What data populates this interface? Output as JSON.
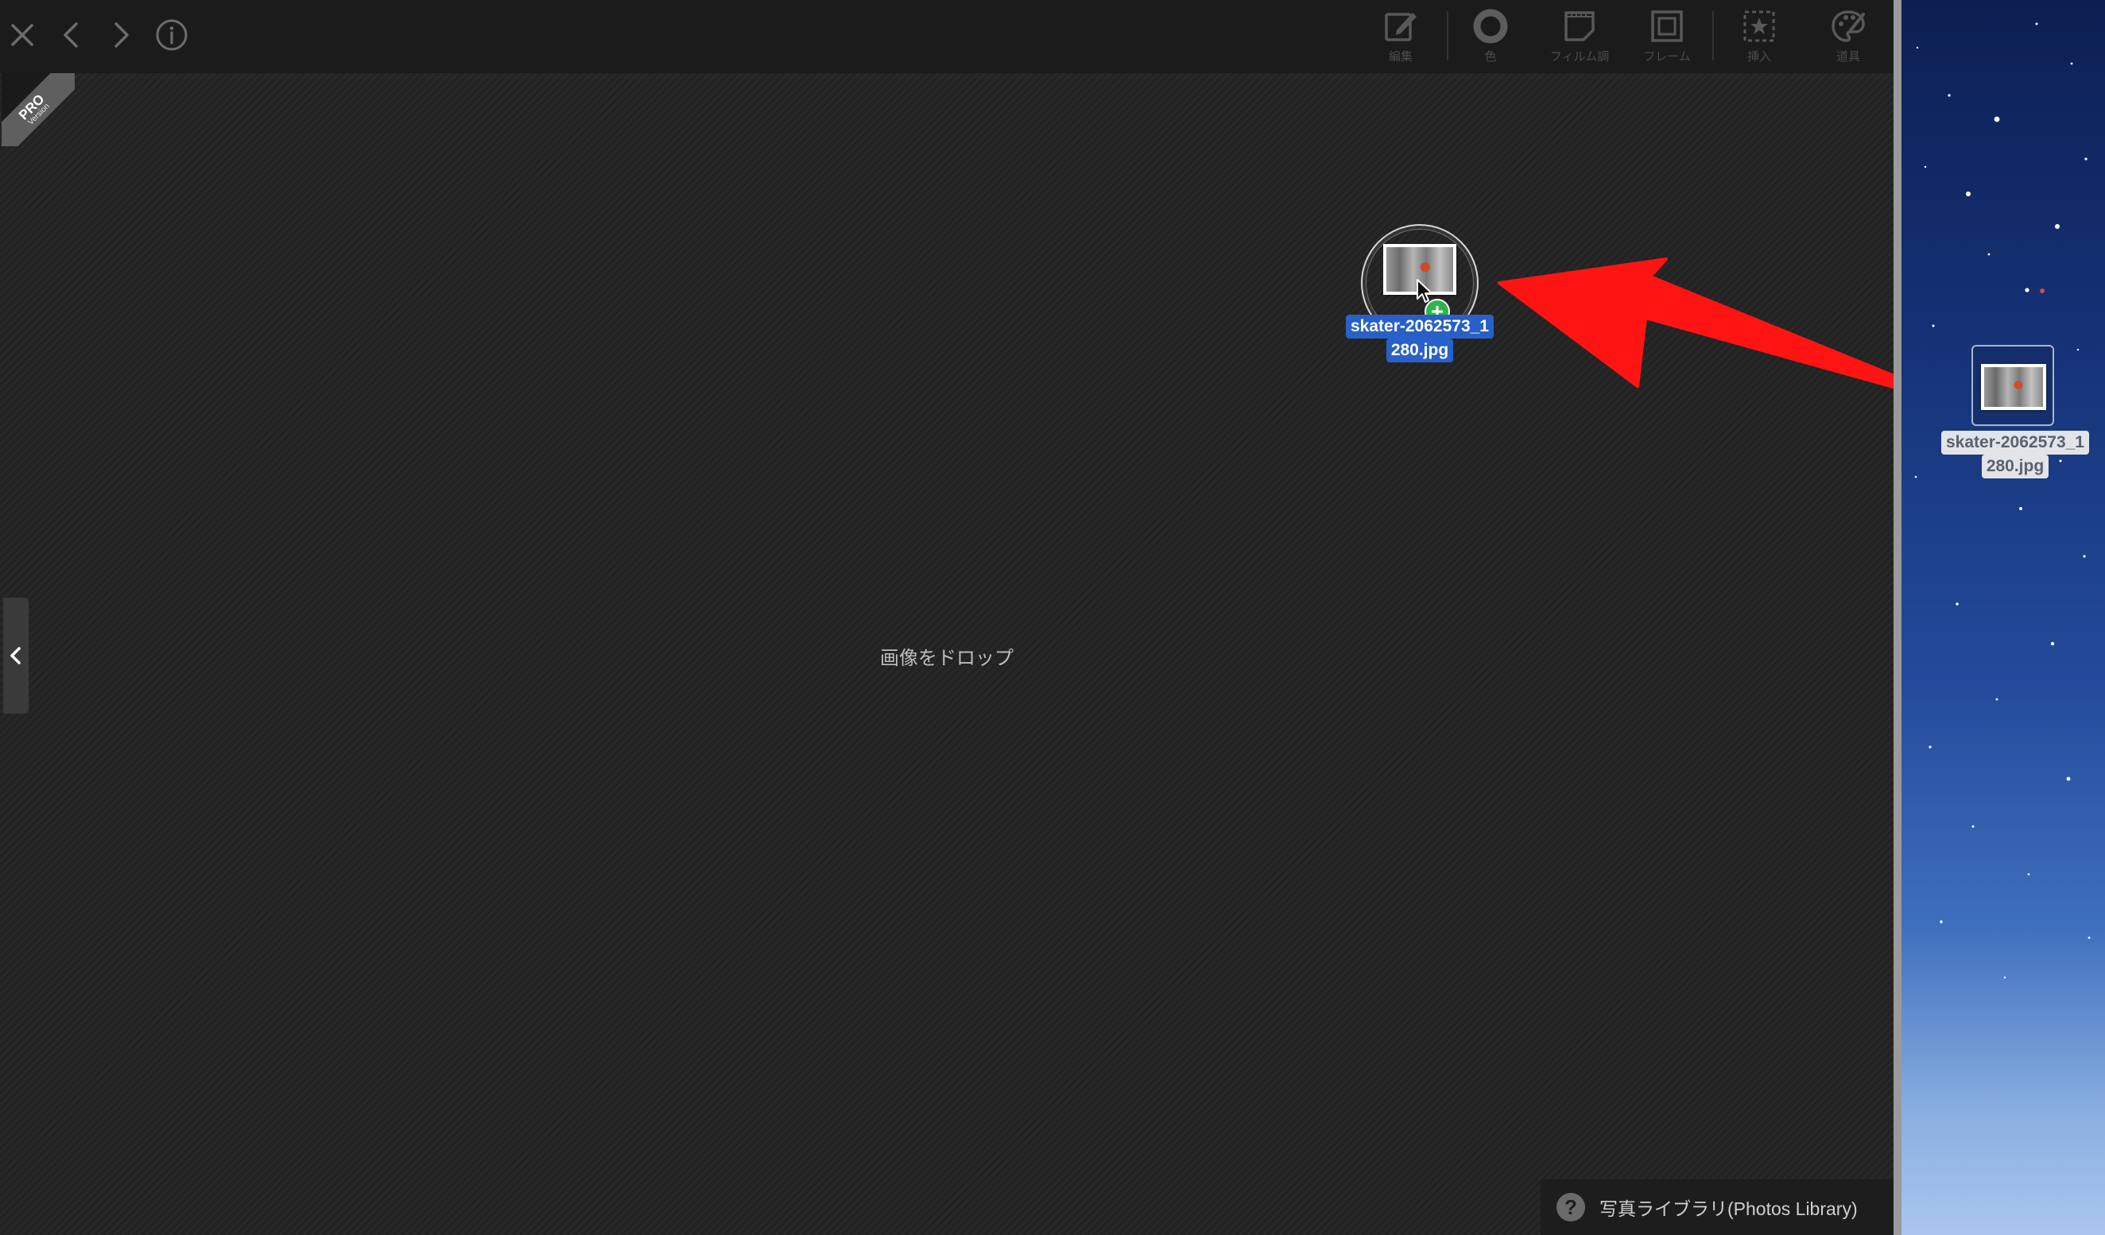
{
  "toolbar": {
    "nav": [
      {
        "name": "close-icon"
      },
      {
        "name": "back-icon"
      },
      {
        "name": "forward-icon"
      },
      {
        "name": "info-icon"
      }
    ],
    "tools": [
      {
        "label": "編集",
        "icon": "edit-icon"
      },
      {
        "label": "色",
        "icon": "color-icon"
      },
      {
        "label": "フィルム調",
        "icon": "film-icon"
      },
      {
        "label": "フレーム",
        "icon": "frame-icon"
      },
      {
        "label": "挿入",
        "icon": "insert-icon"
      },
      {
        "label": "道具",
        "icon": "tools-icon"
      }
    ]
  },
  "badge": {
    "pro": "PRO",
    "version": "Version"
  },
  "canvas": {
    "drop_hint": "画像をドロップ"
  },
  "drag": {
    "filename_line1": "skater-2062573_1",
    "filename_line2": "280.jpg",
    "badge_symbol": "+"
  },
  "library": {
    "help_symbol": "?",
    "label": "写真ライブラリ(Photos Library)"
  },
  "desktop": {
    "file_line1": "skater-2062573_1",
    "file_line2": "280.jpg"
  },
  "colors": {
    "toolbar_bg": "#1b1b1b",
    "canvas_bg": "#242424",
    "arrow": "#ff1414",
    "selection": "#2860c8",
    "plus_badge": "#2fb44a"
  }
}
